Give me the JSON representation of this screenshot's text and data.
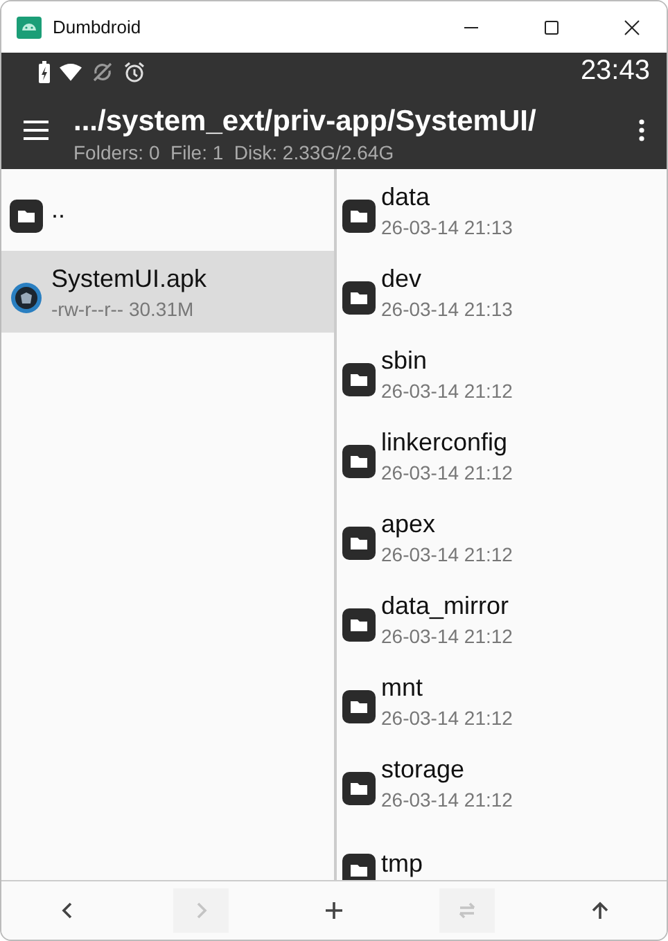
{
  "window": {
    "title": "Dumbdroid"
  },
  "status_bar": {
    "time": "23:43"
  },
  "toolbar": {
    "path": ".../system_ext/priv-app/SystemUI/",
    "summary": "Folders: 0  File: 1  Disk: 2.33G/2.64G"
  },
  "left_pane": {
    "items": [
      {
        "kind": "folder",
        "name": "..",
        "selected": false
      },
      {
        "kind": "apk",
        "name": "SystemUI.apk",
        "details": "-rw-r--r-- 30.31M",
        "selected": true
      }
    ]
  },
  "right_pane": {
    "items": [
      {
        "name": "data",
        "date": "26-03-14 21:13"
      },
      {
        "name": "dev",
        "date": "26-03-14 21:13"
      },
      {
        "name": "sbin",
        "date": "26-03-14 21:12"
      },
      {
        "name": "linkerconfig",
        "date": "26-03-14 21:12"
      },
      {
        "name": "apex",
        "date": "26-03-14 21:12"
      },
      {
        "name": "data_mirror",
        "date": "26-03-14 21:12"
      },
      {
        "name": "mnt",
        "date": "26-03-14 21:12"
      },
      {
        "name": "storage",
        "date": "26-03-14 21:12"
      },
      {
        "name": "tmp"
      }
    ]
  },
  "bottom_bar": [
    {
      "kind": "back",
      "disabled": false
    },
    {
      "kind": "forward",
      "disabled": true
    },
    {
      "kind": "add",
      "disabled": false
    },
    {
      "kind": "swap",
      "disabled": true
    },
    {
      "kind": "up",
      "disabled": false
    }
  ]
}
